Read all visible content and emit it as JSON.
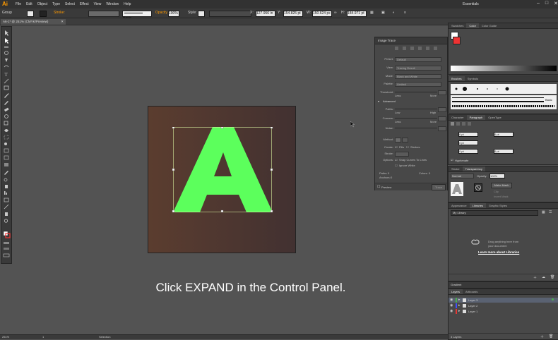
{
  "app": {
    "logo": "Ai"
  },
  "menubar": {
    "items": [
      "File",
      "Edit",
      "Object",
      "Type",
      "Select",
      "Effect",
      "View",
      "Window",
      "Help"
    ],
    "workspace": "Essentials",
    "window_controls": [
      "–",
      "□",
      "✕"
    ]
  },
  "control_bar": {
    "selection_type": "Group",
    "stroke_weight": "",
    "brush_label": "Basic",
    "opacity_label": "Opacity",
    "opacity_value": "100%",
    "style_label": "Style:",
    "x_value": "127.956 in",
    "y_value": "154.825 pt",
    "w_value": "150.624 px",
    "h_value": "184.971 pt"
  },
  "document_tab": {
    "title": "A6-1* @ 251% (CMYK/Preview)",
    "close": "✕"
  },
  "canvas": {
    "artboard_color": "#4f3530",
    "letter": "A",
    "letter_color": "#5cff5c",
    "bbox_color": "#d8f0a0"
  },
  "caption": "Click EXPAND in the Control Panel.",
  "image_trace": {
    "title": "Image Trace",
    "rows": [
      {
        "label": "Preset:",
        "value": "Default"
      },
      {
        "label": "View:",
        "value": "Tracing Result"
      },
      {
        "label": "Mode:",
        "value": "Black and White"
      },
      {
        "label": "Palette:",
        "value": "Limited"
      }
    ],
    "threshold_label": "Threshold:",
    "less": "Less",
    "more": "More",
    "advanced_label": "Advanced",
    "paths_label": "Paths:",
    "corners_label": "Corners:",
    "noise_label": "Noise:",
    "low": "Low",
    "high": "High",
    "method_label": "Method:",
    "create_label": "Create:",
    "fills": "Fills",
    "strokes": "Strokes",
    "stroke_label": "Stroke:",
    "options_label": "Options:",
    "snap_curves": "Snap Curves To Lines",
    "ignore_white": "Ignore White",
    "paths_count_label": "Paths:",
    "paths_count": "0",
    "anchors_label": "Anchors:",
    "anchors_count": "0",
    "colors_label": "Colors:",
    "colors_count": "0",
    "preview_label": "Preview",
    "trace_label": "Trace"
  },
  "panels": {
    "swatches_tabs": [
      "Swatches",
      "Color",
      "Color Guide"
    ],
    "brushes_tabs": [
      "Brushes",
      "Symbols"
    ],
    "brush_basic": "Basic",
    "character_tabs": [
      "Character",
      "Paragraph",
      "OpenType"
    ],
    "para_values": [
      "0 pt",
      "0 pt",
      "0 pt",
      "0 pt",
      "0 pt"
    ],
    "hyphenate": "Hyphenate",
    "stroke_tabs": [
      "Stroke",
      "Transparency"
    ],
    "blend_mode": "Normal",
    "opacity_label": "Opacity:",
    "opacity_value": "100%",
    "make_mask": "Make Mask",
    "clip": "Clip",
    "invert_mask": "Invert Mask",
    "appearance_tabs": [
      "Appearance",
      "Libraries",
      "Graphic Styles"
    ],
    "library_name": "My Library",
    "library_msg_line1": "Drag anything here from",
    "library_msg_line2": "your document",
    "library_link": "Learn more about Libraries",
    "gradient_title": "Gradient",
    "layers_tabs": [
      "Layers",
      "Artboards"
    ],
    "layers": [
      {
        "name": "Layer 3",
        "color": "#4caf50"
      },
      {
        "name": "Layer 2",
        "color": "#3f51ff"
      },
      {
        "name": "Layer 1",
        "color": "#e53935"
      }
    ],
    "layers_count": "3 Layers"
  },
  "status": {
    "zoom": "251%",
    "page": "1",
    "tool": "Selection"
  }
}
